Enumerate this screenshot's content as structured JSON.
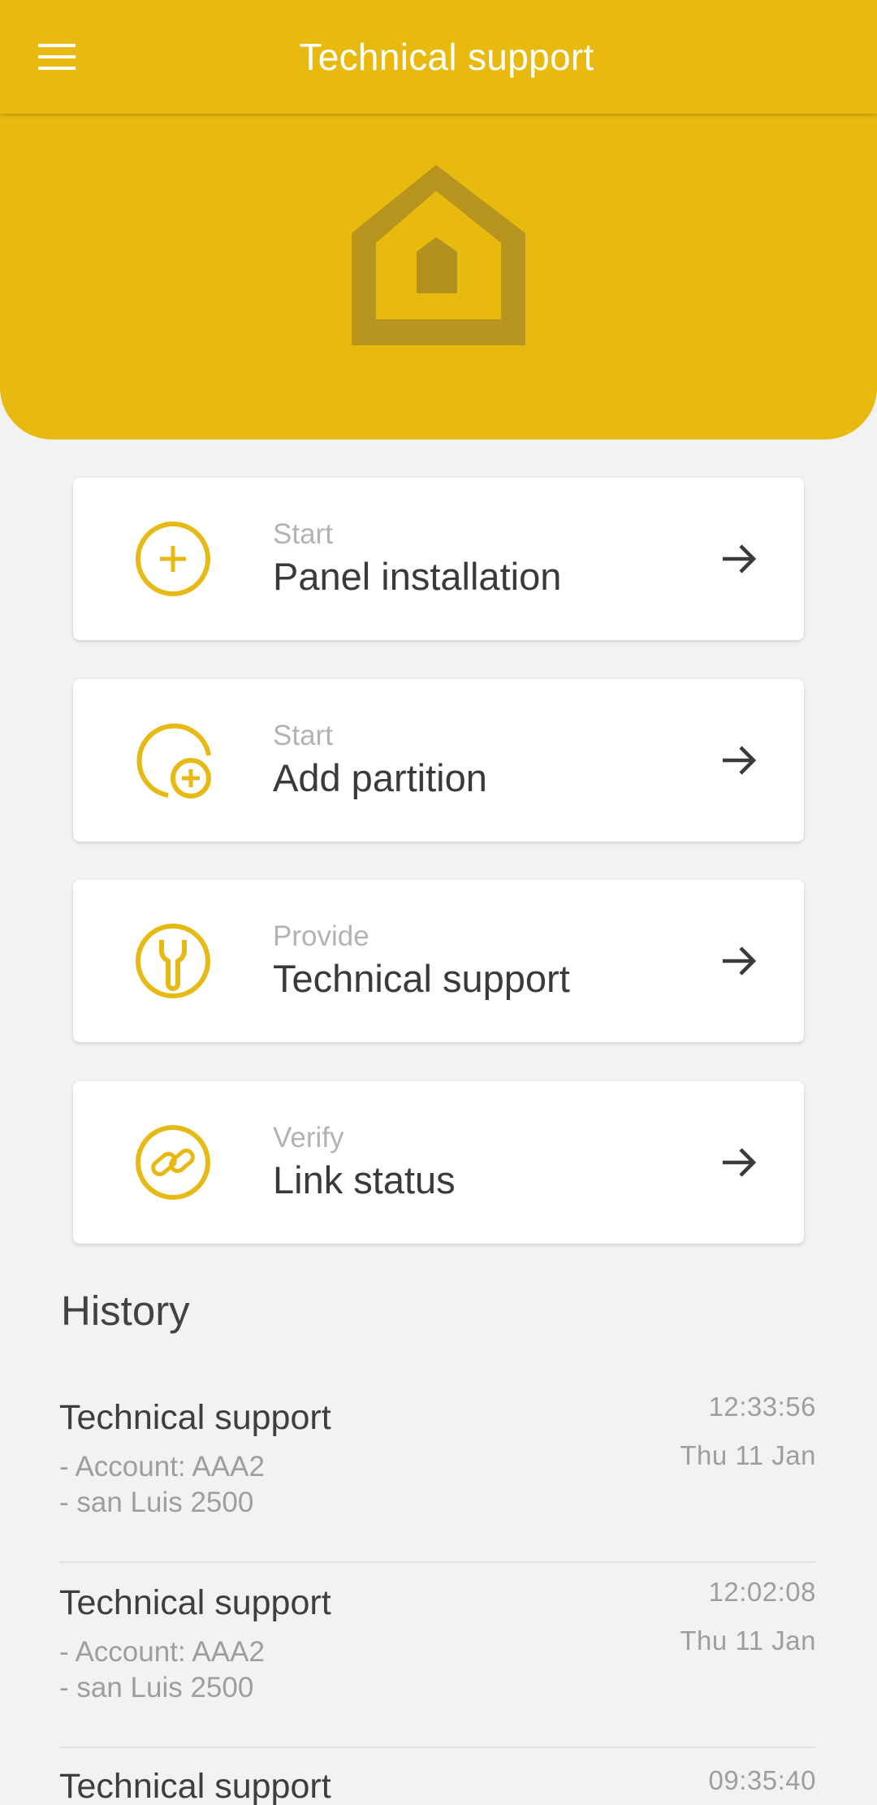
{
  "appbar": {
    "title": "Technical support",
    "menu_icon": "hamburger-menu-icon"
  },
  "hero": {
    "logo_icon": "house-logo-icon"
  },
  "colors": {
    "brand_yellow": "#e8b90f",
    "icon_yellow": "#e6b914",
    "logo_overlay": "#b3911f",
    "background": "#f2f2f2"
  },
  "actions": [
    {
      "subtitle": "Start",
      "title": "Panel installation",
      "icon": "plus-circle-icon",
      "arrow": "arrow-right-icon"
    },
    {
      "subtitle": "Start",
      "title": "Add partition",
      "icon": "add-partition-icon",
      "arrow": "arrow-right-icon"
    },
    {
      "subtitle": "Provide",
      "title": "Technical support",
      "icon": "wrench-icon",
      "arrow": "arrow-right-icon"
    },
    {
      "subtitle": "Verify",
      "title": "Link status",
      "icon": "link-icon",
      "arrow": "arrow-right-icon"
    }
  ],
  "history": {
    "heading": "History",
    "items": [
      {
        "title": "Technical support",
        "line1": "- Account: AAA2",
        "line2": "- san Luis 2500",
        "time": "12:33:56",
        "date": "Thu 11 Jan"
      },
      {
        "title": "Technical support",
        "line1": "- Account: AAA2",
        "line2": "- san Luis 2500",
        "time": "12:02:08",
        "date": "Thu 11 Jan"
      },
      {
        "title": "Technical support",
        "time": "09:35:40"
      }
    ]
  }
}
